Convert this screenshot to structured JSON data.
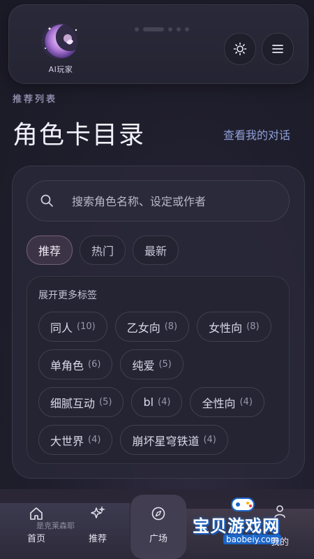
{
  "header": {
    "logo_text": "AI玩家"
  },
  "title_section": {
    "kicker": "推荐列表",
    "title": "角色卡目录",
    "view_link": "查看我的对话"
  },
  "search": {
    "placeholder": "搜索角色名称、设定或作者"
  },
  "tabs": [
    {
      "label": "推荐",
      "active": true
    },
    {
      "label": "热门",
      "active": false
    },
    {
      "label": "最新",
      "active": false
    }
  ],
  "tag_section": {
    "title": "展开更多标签",
    "tags": [
      {
        "label": "同人",
        "count": "(10)"
      },
      {
        "label": "乙女向",
        "count": "(8)"
      },
      {
        "label": "女性向",
        "count": "(8)"
      },
      {
        "label": "单角色",
        "count": "(6)"
      },
      {
        "label": "纯爱",
        "count": "(5)"
      },
      {
        "label": "细腻互动",
        "count": "(5)"
      },
      {
        "label": "bl",
        "count": "(4)"
      },
      {
        "label": "全性向",
        "count": "(4)"
      },
      {
        "label": "大世界",
        "count": "(4)"
      },
      {
        "label": "崩坏星穹铁道",
        "count": "(4)"
      }
    ]
  },
  "background": {
    "card_caption": "是克莱森耶"
  },
  "bottom_nav": {
    "items": [
      {
        "label": "首页",
        "icon": "home-icon"
      },
      {
        "label": "推荐",
        "icon": "sparkle-icon"
      },
      {
        "label": "广场",
        "icon": "compass-icon",
        "active": true
      },
      {
        "label": "我的",
        "icon": "user-icon"
      }
    ]
  },
  "watermark": {
    "title": "宝贝游戏网",
    "url": "baobeiy.com"
  },
  "colors": {
    "background": "#1e1d2b",
    "accent_link": "#8fa0d8",
    "active_tab": "#3c3446"
  }
}
